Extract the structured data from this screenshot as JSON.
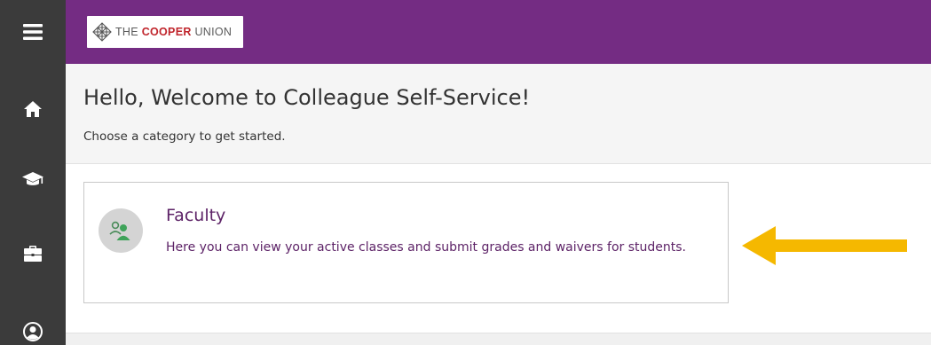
{
  "sidebar": {
    "items": [
      {
        "icon": "menu-icon",
        "label": "Menu"
      },
      {
        "icon": "home-icon",
        "label": "Home"
      },
      {
        "icon": "graduation-cap-icon",
        "label": "Student"
      },
      {
        "icon": "briefcase-icon",
        "label": "Employee"
      },
      {
        "icon": "user-circle-icon",
        "label": "User"
      }
    ]
  },
  "header": {
    "logo": {
      "the": "THE",
      "cooper": "COOPER",
      "union": "UNION"
    },
    "brand_color": "#742c83"
  },
  "welcome": {
    "title": "Hello, Welcome to Colleague Self-Service!",
    "subtitle": "Choose a category to get started."
  },
  "categories": [
    {
      "title": "Faculty",
      "description": "Here you can view your active classes and submit grades and waivers for students.",
      "icon": "faculty-icon",
      "text_color": "#5d2367"
    }
  ],
  "annotation": {
    "icon": "arrow-left-icon",
    "color": "#f5b800"
  }
}
